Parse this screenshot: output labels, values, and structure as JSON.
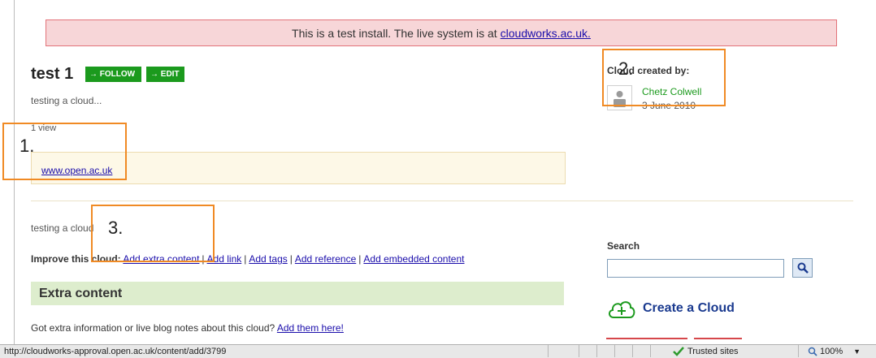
{
  "banner": {
    "text": "This is a test install. The live system is at",
    "link": "cloudworks.ac.uk."
  },
  "cloud": {
    "title": "test 1",
    "follow_label": "→ FOLLOW",
    "edit_label": "→ EDIT",
    "subtitle": "testing a cloud...",
    "views": "1 view",
    "link": "www.open.ac.uk",
    "description": "testing a cloud"
  },
  "improve": {
    "label": "Improve this cloud:",
    "links": [
      "Add extra content",
      "Add link",
      "Add tags",
      "Add reference",
      "Add embedded content"
    ]
  },
  "extra_content": {
    "heading": "Extra content",
    "text": "Got extra information or live blog notes about this cloud?",
    "link": "Add them here!"
  },
  "sidebar": {
    "created_by": "Cloud created by:",
    "author": "Chetz Colwell",
    "date": "3 June 2010",
    "search_label": "Search",
    "search_value": "",
    "create_label": "Create a Cloud"
  },
  "annotations": [
    "1.",
    "2.",
    "3."
  ],
  "statusbar": {
    "url": "http://cloudworks-approval.open.ac.uk/content/add/3799",
    "zone": "Trusted sites",
    "zoom": "100%"
  },
  "colors": {
    "accent_green": "#1b9a1d",
    "banner_bg": "#f7d6d8",
    "annotation_orange": "#f08a24"
  }
}
